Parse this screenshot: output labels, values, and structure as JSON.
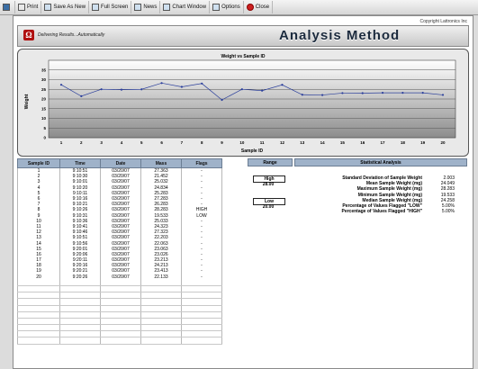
{
  "toolbar": {
    "items": [
      "Print",
      "Save As New",
      "Full Screen",
      "News",
      "Chart Window",
      "Options",
      "Close"
    ]
  },
  "header": {
    "copyright": "Copyright Lattronics Inc",
    "logo_letter": "Ω",
    "tagline": "Delivering Results...Automatically",
    "title": "Analysis Method"
  },
  "chart_data": {
    "type": "line",
    "title": "Weight vs Sample ID",
    "xlabel": "Sample ID",
    "ylabel": "Weight",
    "x": [
      1,
      2,
      3,
      4,
      5,
      6,
      7,
      8,
      9,
      10,
      11,
      12,
      13,
      14,
      15,
      16,
      17,
      18,
      19,
      20
    ],
    "values": [
      27.36,
      21.45,
      25.03,
      24.83,
      25.0,
      28.23,
      26.29,
      28.0,
      19.53,
      25.03,
      24.32,
      27.32,
      22.2,
      22.06,
      23.06,
      23.03,
      23.2,
      23.21,
      23.21,
      22.13
    ],
    "ylim": [
      0,
      40
    ],
    "yticks": [
      0,
      5,
      10,
      15,
      20,
      25,
      30,
      35
    ],
    "color": "#2b3f9c"
  },
  "table": {
    "headers": [
      "Sample ID",
      "Time",
      "Date",
      "Mass",
      "Flags"
    ],
    "rows": [
      [
        "1",
        "9:10:51",
        "03/20/07",
        "27.363",
        "-"
      ],
      [
        "2",
        "9:10:30",
        "03/20/07",
        "21.452",
        "-"
      ],
      [
        "3",
        "9:10:01",
        "03/20/07",
        "25.032",
        "-"
      ],
      [
        "4",
        "9:10:20",
        "03/20/07",
        "24.834",
        "-"
      ],
      [
        "5",
        "9:10:11",
        "03/20/07",
        "25.283",
        "-"
      ],
      [
        "6",
        "9:10:16",
        "03/20/07",
        "27.283",
        "-"
      ],
      [
        "7",
        "9:10:21",
        "03/20/07",
        "26.283",
        "-"
      ],
      [
        "8",
        "9:10:26",
        "03/20/07",
        "28.283",
        "HIGH"
      ],
      [
        "9",
        "9:10:31",
        "03/20/07",
        "19.533",
        "LOW"
      ],
      [
        "10",
        "9:10:36",
        "03/20/07",
        "25.033",
        "-"
      ],
      [
        "11",
        "9:10:41",
        "03/20/07",
        "24.323",
        "-"
      ],
      [
        "12",
        "9:10:46",
        "03/20/07",
        "27.323",
        "-"
      ],
      [
        "13",
        "9:10:51",
        "03/20/07",
        "22.203",
        "-"
      ],
      [
        "14",
        "9:10:56",
        "03/20/07",
        "22.063",
        "-"
      ],
      [
        "15",
        "9:20:01",
        "03/20/07",
        "23.063",
        "-"
      ],
      [
        "16",
        "9:20:06",
        "03/20/07",
        "23.026",
        "-"
      ],
      [
        "17",
        "9:20:11",
        "03/20/07",
        "23.213",
        "-"
      ],
      [
        "18",
        "9:20:16",
        "03/20/07",
        "24.213",
        "-"
      ],
      [
        "19",
        "9:20:21",
        "03/20/07",
        "23.413",
        "-"
      ],
      [
        "20",
        "9:20:26",
        "03/20/07",
        "22.133",
        "-"
      ]
    ],
    "empty_rows": 10
  },
  "range": {
    "header": "Range",
    "high_label": "High",
    "high_value": "28.00",
    "low_label": "Low",
    "low_value": "20.00"
  },
  "stats": {
    "header": "Statistical Analysis",
    "rows": [
      {
        "label": "Standard Deviation of Sample Weight",
        "value": "2.003"
      },
      {
        "label": "Mean Sample Weight (mg)",
        "value": "24.049"
      },
      {
        "label": "Maximum Sample Weight (mg)",
        "value": "28.283"
      },
      {
        "label": "Minimum Sample Weight (mg)",
        "value": "19.533"
      },
      {
        "label": "Median Sample Weight (mg)",
        "value": "24.258"
      },
      {
        "label": "Percentage of Values Flagged \"LOW\"",
        "value": "5.00%"
      },
      {
        "label": "Percentage of Values Flagged \"HIGH\"",
        "value": "5.00%"
      }
    ]
  }
}
